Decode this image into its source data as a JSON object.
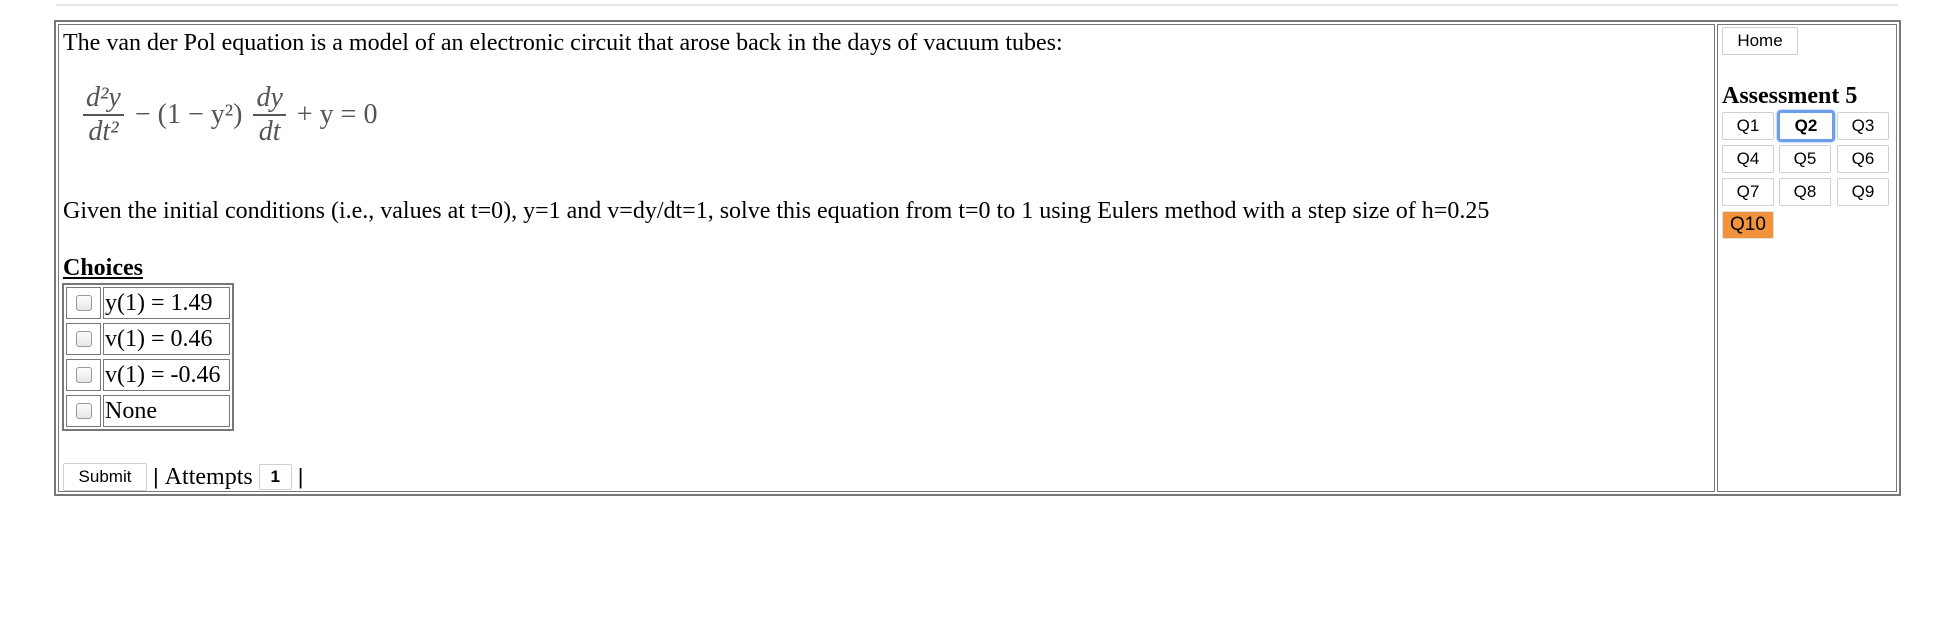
{
  "question": {
    "intro": "The van der Pol equation is a model of an electronic circuit that arose back in the days of vacuum tubes:",
    "equation": {
      "term1_num": "d²y",
      "term1_den": "dt²",
      "middle": "− (1 − y²)",
      "term2_num": "dy",
      "term2_den": "dt",
      "tail": "+ y = 0"
    },
    "text": "Given the initial conditions (i.e., values at t=0), y=1 and v=dy/dt=1, solve this equation from t=0 to 1 using Eulers method with a step size of h=0.25"
  },
  "choices": {
    "title": "Choices",
    "items": [
      {
        "label": "y(1) = 1.49",
        "checked": false
      },
      {
        "label": "v(1) = 0.46",
        "checked": false
      },
      {
        "label": "v(1) = -0.46",
        "checked": false
      },
      {
        "label": "None",
        "checked": false
      }
    ]
  },
  "footer": {
    "submit_label": "Submit",
    "separator": "|",
    "attempts_label": "Attempts",
    "attempts_value": "1"
  },
  "sidebar": {
    "home_label": "Home",
    "assessment_title": "Assessment 5",
    "questions": [
      {
        "label": "Q1",
        "state": "normal"
      },
      {
        "label": "Q2",
        "state": "active"
      },
      {
        "label": "Q3",
        "state": "normal"
      },
      {
        "label": "Q4",
        "state": "normal"
      },
      {
        "label": "Q5",
        "state": "normal"
      },
      {
        "label": "Q6",
        "state": "normal"
      },
      {
        "label": "Q7",
        "state": "normal"
      },
      {
        "label": "Q8",
        "state": "normal"
      },
      {
        "label": "Q9",
        "state": "normal"
      },
      {
        "label": "Q10",
        "state": "flagged"
      }
    ]
  },
  "colors": {
    "active_outline": "#6d9eeb",
    "flagged_bg": "#f2923a"
  }
}
